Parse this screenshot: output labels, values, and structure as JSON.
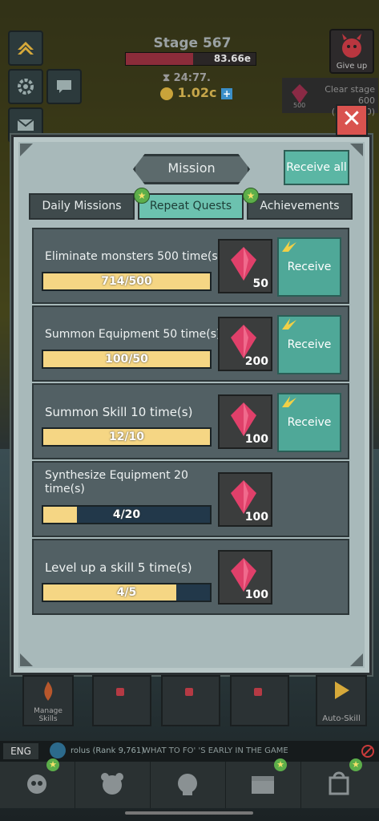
{
  "hud": {
    "stage_title": "Stage 567",
    "boss_hp": "83.66e",
    "timer": "24:77.",
    "gold": "1.02c",
    "give_up_label": "Give up",
    "clear_stage_label": "Clear stage",
    "clear_stage_progress": "600 (567/600)",
    "clear_stage_reward": "500"
  },
  "modal": {
    "title": "Mission",
    "receive_all_label": "Receive all",
    "tabs": [
      {
        "label": "Daily Missions",
        "active": false
      },
      {
        "label": "Repeat Quests",
        "active": true
      },
      {
        "label": "Achievements",
        "active": false
      }
    ],
    "quests": [
      {
        "title": "Eliminate monsters 500 time(s)",
        "progress_text": "714/500",
        "progress": 1.0,
        "reward": "50",
        "receive_label": "Receive",
        "claimable": true
      },
      {
        "title": "Summon Equipment 50 time(s)",
        "progress_text": "100/50",
        "progress": 1.0,
        "reward": "200",
        "receive_label": "Receive",
        "claimable": true
      },
      {
        "title": "Summon Skill 10 time(s)",
        "progress_text": "12/10",
        "progress": 1.0,
        "reward": "100",
        "receive_label": "Receive",
        "claimable": true
      },
      {
        "title": "Synthesize Equipment 20 time(s)",
        "progress_text": "4/20",
        "progress": 0.2,
        "reward": "100",
        "claimable": false
      },
      {
        "title": "Level up a skill 5 time(s)",
        "progress_text": "4/5",
        "progress": 0.8,
        "reward": "100",
        "claimable": false
      }
    ]
  },
  "bottom": {
    "manage_skills_label": "Manage Skills",
    "auto_skill_label": "Auto-Skill",
    "language": "ENG",
    "chat_name": "rolus (Rank 9,761)",
    "chat_message": "WHAT TO FO' 'S EARLY IN THE GAME"
  },
  "colors": {
    "accent": "#5bb6a4",
    "progress_fill": "#f5d684",
    "gem": "#e0406a"
  }
}
